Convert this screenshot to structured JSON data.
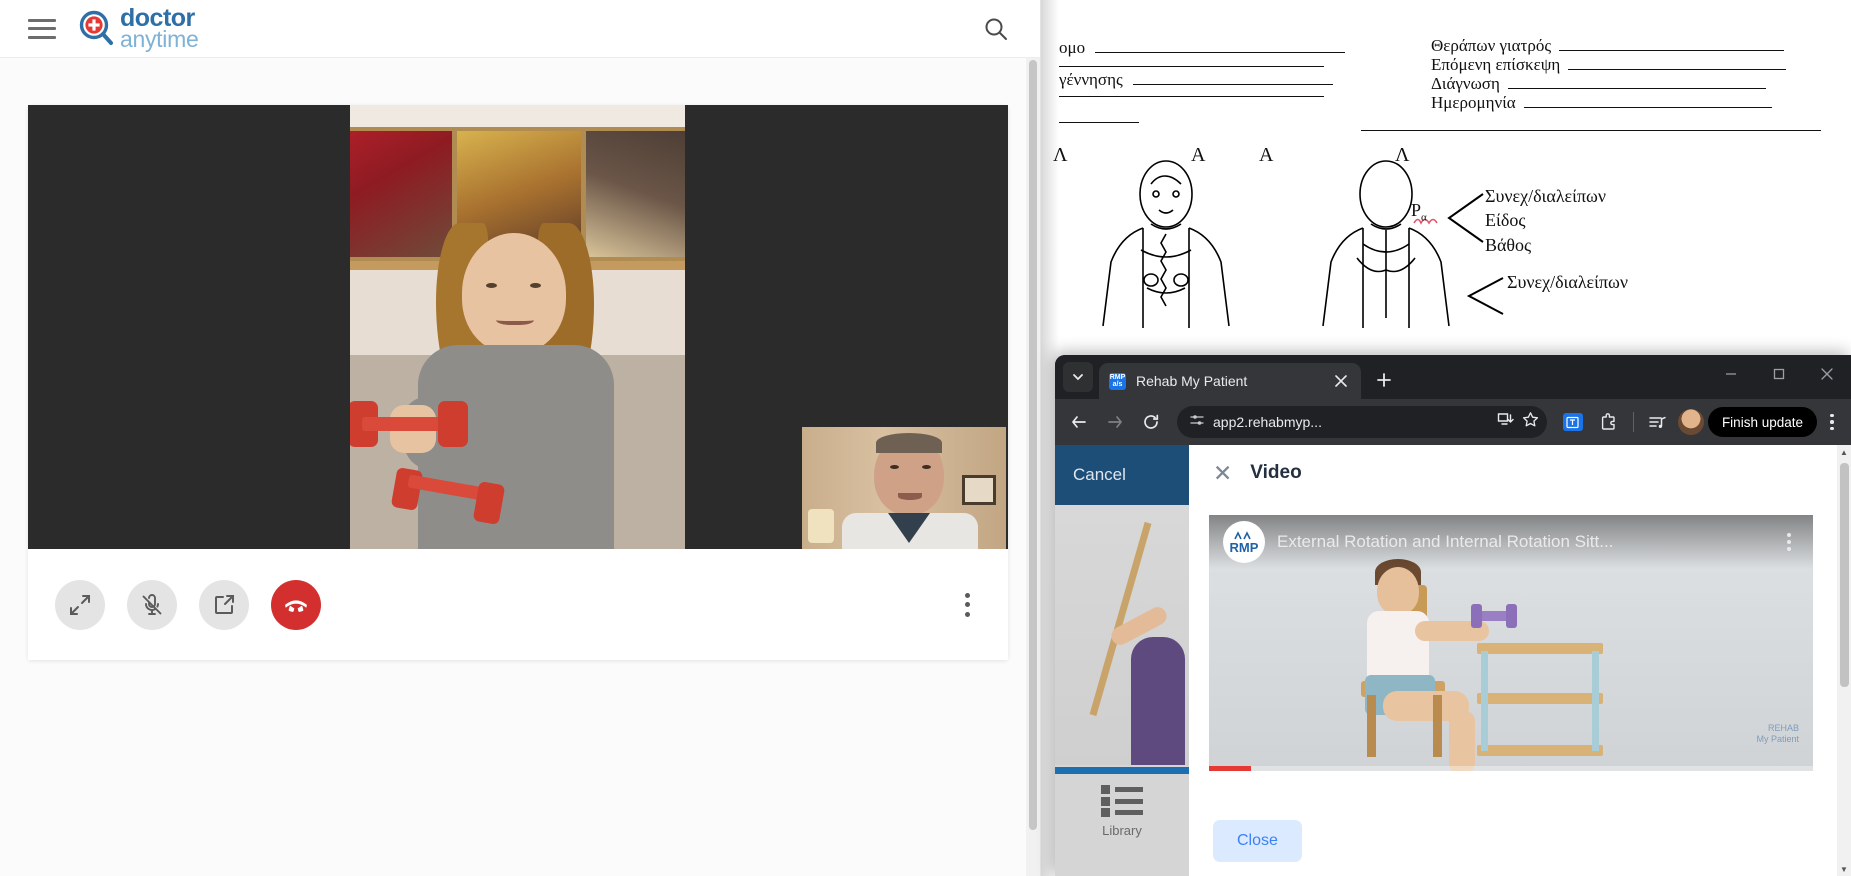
{
  "doctoranytime": {
    "logo_line1": "doctor",
    "logo_line2": "anytime",
    "menu_icon": "hamburger-icon",
    "search_icon": "search-icon",
    "controls": [
      {
        "name": "expand",
        "label": "Expand"
      },
      {
        "name": "mic-muted",
        "label": "Microphone muted"
      },
      {
        "name": "share-screen",
        "label": "Share screen"
      },
      {
        "name": "end-call",
        "label": "End call"
      }
    ],
    "more_label": "More options"
  },
  "document": {
    "fields_left": [
      {
        "label": "ομο"
      },
      {
        "label": "γέννησης"
      }
    ],
    "fields_right": [
      {
        "label": "Θεράπων γιατρός"
      },
      {
        "label": "Επόμενη επίσκεψη"
      },
      {
        "label": "Διάγνωση"
      },
      {
        "label": "Ημερομηνία"
      }
    ],
    "figure_marks": [
      "Λ",
      "Α",
      "Α",
      "Λ"
    ],
    "annotation_1": {
      "marker": "Ρα",
      "lines": [
        "Συνεχ/διαλείπων",
        "Είδος",
        "Βάθος"
      ]
    },
    "annotation_2": {
      "lines": [
        "Συνεχ/διαλείπων"
      ]
    }
  },
  "browser": {
    "tab": {
      "title": "Rehab My Patient",
      "favicon_text_top": "RMP",
      "favicon_text_bottom": "a/s"
    },
    "new_tab_label": "+",
    "window_controls": {
      "minimize": "–",
      "maximize": "□",
      "close": "✕"
    },
    "toolbar": {
      "back": "←",
      "forward": "→",
      "reload": "↻",
      "url": "app2.rehabmyp...",
      "site_info_icon": "tune-icon",
      "install_icon": "install-app-icon",
      "bookmark_icon": "star-icon",
      "translate_icon": "translate-icon",
      "extensions_icon": "puzzle-icon",
      "media_icon": "media-controls-icon",
      "profile_icon": "avatar",
      "update_label": "Finish update",
      "menu_icon": "three-dot-menu-icon"
    }
  },
  "rehab_app": {
    "sidebar": {
      "cancel_label": "Cancel",
      "library_label": "Library"
    },
    "modal": {
      "close_icon": "✕",
      "title": "Video",
      "close_button": "Close"
    },
    "player": {
      "logo_text": "RMP",
      "video_title": "External Rotation and Internal Rotation Sitt...",
      "menu_icon": "three-dot-menu-icon",
      "watermark_line1": "REHAB",
      "watermark_line2": "My Patient",
      "progress_percent": "7"
    }
  },
  "colors": {
    "brand_blue": "#2f6fa8",
    "brand_light_blue": "#7fb2d6",
    "hangup_red": "#d32f2f",
    "sidebar_navy": "#1c4e78",
    "close_blue": "#3b82f6",
    "progress_red": "#e53935"
  }
}
